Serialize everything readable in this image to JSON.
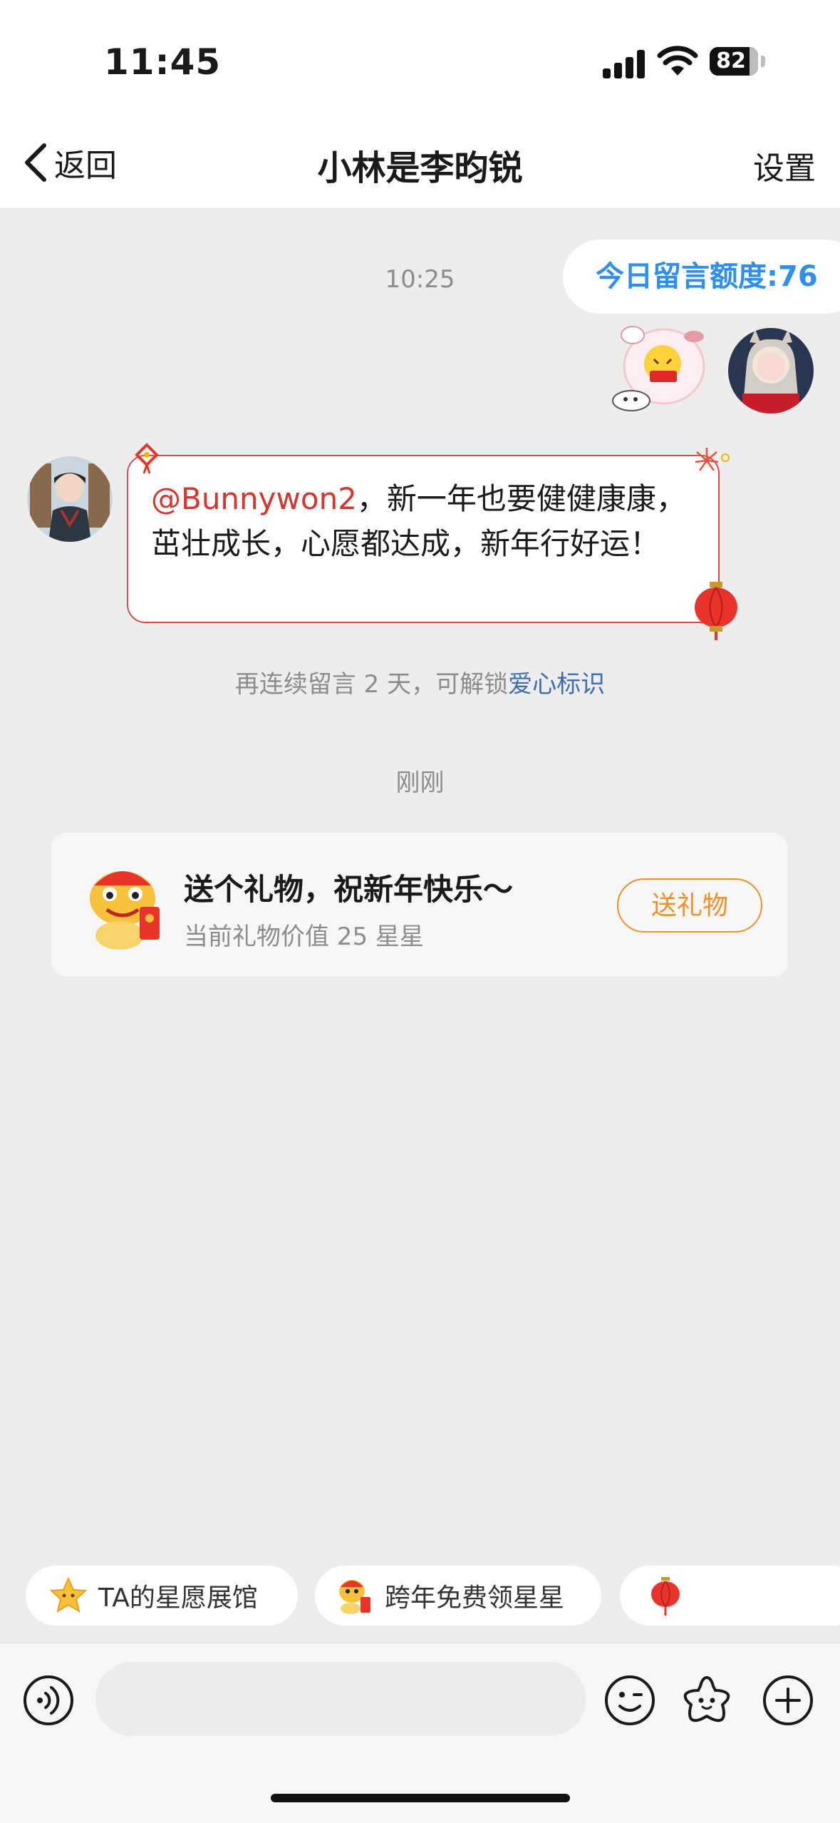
{
  "status_bar": {
    "time": "11:45",
    "battery": "82"
  },
  "nav": {
    "back_label": "返回",
    "title": "小林是李昀锐",
    "settings_label": "设置"
  },
  "chat": {
    "timestamp_1": "10:25",
    "quota_text": "今日留言额度:76",
    "message": {
      "mention": "@Bunnywon2",
      "text": "，新一年也要健健康康，茁壮成长，心愿都达成，新年行好运！"
    },
    "streak_hint": {
      "prefix": "再连续留言 2 天，可解锁",
      "link": "爱心标识"
    },
    "timestamp_2": "刚刚",
    "gift_card": {
      "title": "送个礼物，祝新年快乐～",
      "subtitle": "当前礼物价值 25 星星",
      "button": "送礼物"
    }
  },
  "quick_chips": [
    {
      "label": "TA的星愿展馆",
      "icon": "star-icon"
    },
    {
      "label": "跨年免费领星星",
      "icon": "lion-dance-icon"
    },
    {
      "label": "",
      "icon": "lantern-icon"
    }
  ],
  "input_bar": {
    "icons": [
      "voice-icon",
      "emoji-icon",
      "star-badge-icon",
      "plus-icon"
    ]
  },
  "colors": {
    "accent_blue": "#2f8ff0",
    "mention_red": "#d6342c",
    "gift_orange": "#f0902a",
    "link_blue": "#3d6fb0"
  }
}
